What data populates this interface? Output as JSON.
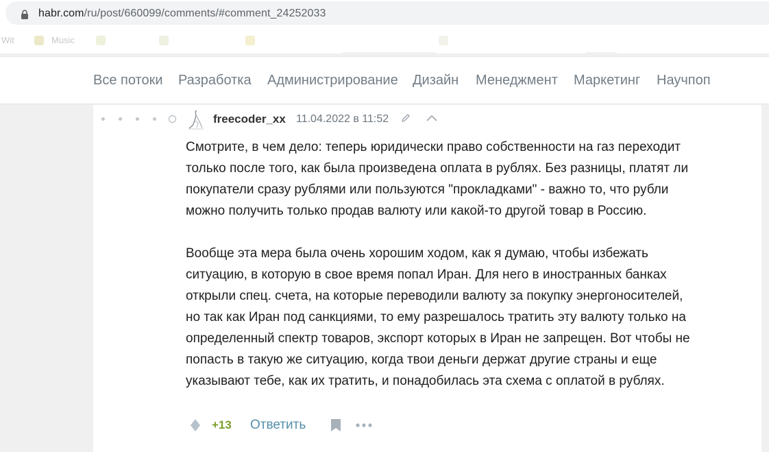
{
  "browser": {
    "url_host": "habr.com",
    "url_path": "/ru/post/660099/comments/#comment_24252033",
    "bookmarks": [
      "Wit",
      "Music"
    ]
  },
  "nav": {
    "items": [
      "Все потоки",
      "Разработка",
      "Администрирование",
      "Дизайн",
      "Менеджмент",
      "Маркетинг",
      "Научпоп"
    ]
  },
  "comment": {
    "author": "freecoder_xx",
    "timestamp": "11.04.2022 в 11:52",
    "paragraph1": [
      "Смотрите, в чем дело: теперь юридически право собственности на газ переходит",
      "только после того, как была произведена оплата в рублях. Без разницы, платят ли",
      "покупатели сразу рублями или пользуются \"прокладками\" - важно то, что рубли",
      "можно получить только продав валюту или какой-то другой товар в Россию."
    ],
    "paragraph2": [
      "Вообще эта мера была очень хорошим ходом, как я думаю, чтобы избежать",
      "ситуацию, в которую в свое время попал Иран. Для него в иностранных банках",
      "открыли спец. счета, на которые переводили валюту за покупку энергоносителей,",
      "но так как Иран под санкциями, то ему разрешалось тратить эту валюту только на",
      "определенный спектр товаров, экспорт которых в Иран не запрещен. Вот чтобы не",
      "попасть в такую же ситуацию, когда твои деньги держат другие страны и еще",
      "указывают тебе, как их тратить, и понадобилась эта схема с оплатой в рублях."
    ],
    "score": "+13",
    "reply_label": "Ответить"
  },
  "colors": {
    "score": "#7b9f2e",
    "link": "#548eaa",
    "nav_text": "#737d86"
  }
}
